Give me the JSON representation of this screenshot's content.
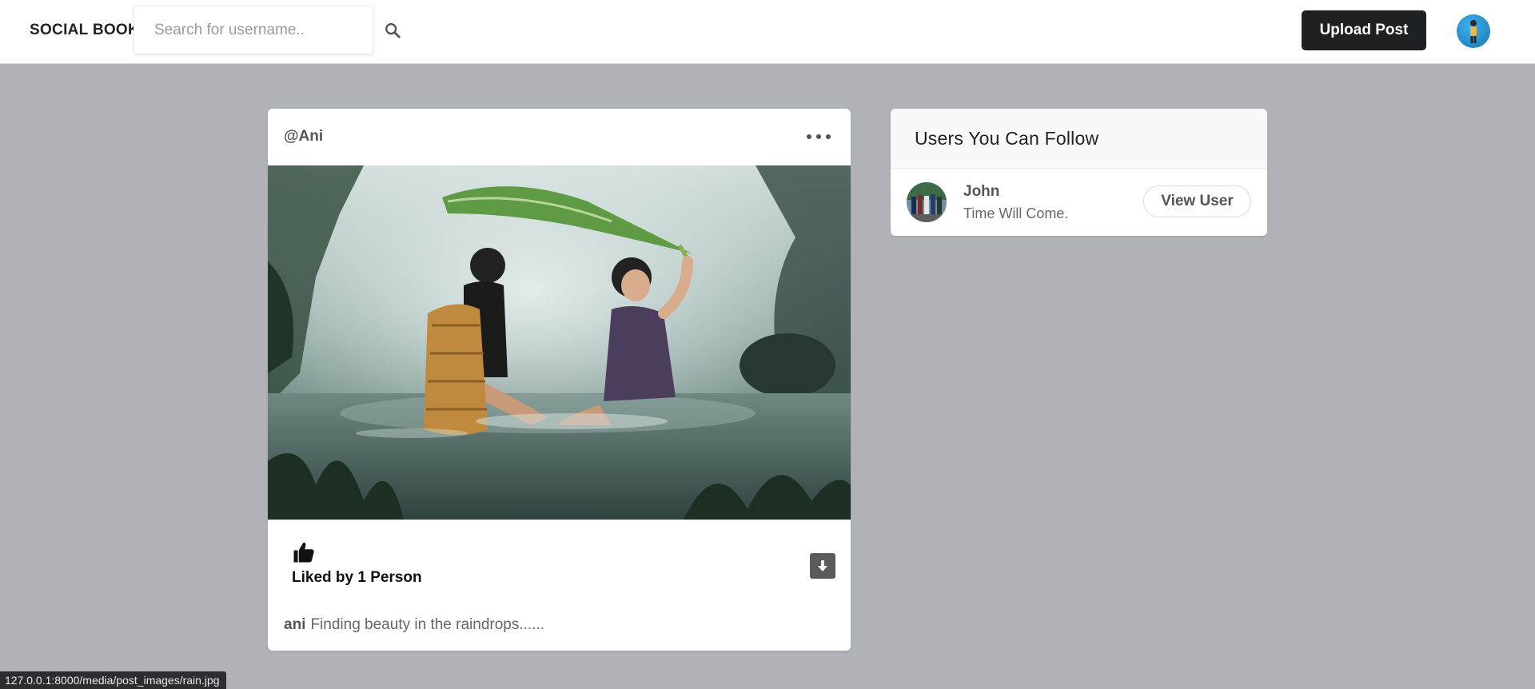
{
  "header": {
    "brand": "SOCIAL BOOK",
    "search_placeholder": "Search for username..",
    "search_icon": "search-icon",
    "upload_label": "Upload Post",
    "avatar": "user-avatar"
  },
  "post": {
    "username": "@Ani",
    "menu_icon": "more-horizontal-icon",
    "image_alt": "Two girls sitting in water in the rain under a large leaf",
    "like_icon": "thumbs-up-icon",
    "liked_by": "Liked by 1 Person",
    "download_icon": "download-icon",
    "caption_user": "ani",
    "caption_text": "Finding beauty in the raindrops......"
  },
  "sidebar": {
    "title": "Users You Can Follow",
    "users": [
      {
        "name": "John",
        "bio": "Time Will Come.",
        "button": "View User"
      }
    ]
  },
  "status_bar": {
    "url": "127.0.0.1:8000/media/post_images/rain.jpg"
  },
  "colors": {
    "page_bg": "#afb2b6",
    "header_bg": "#ffffff",
    "button_dark": "#1f2023",
    "status_bg": "#2b2d31"
  }
}
